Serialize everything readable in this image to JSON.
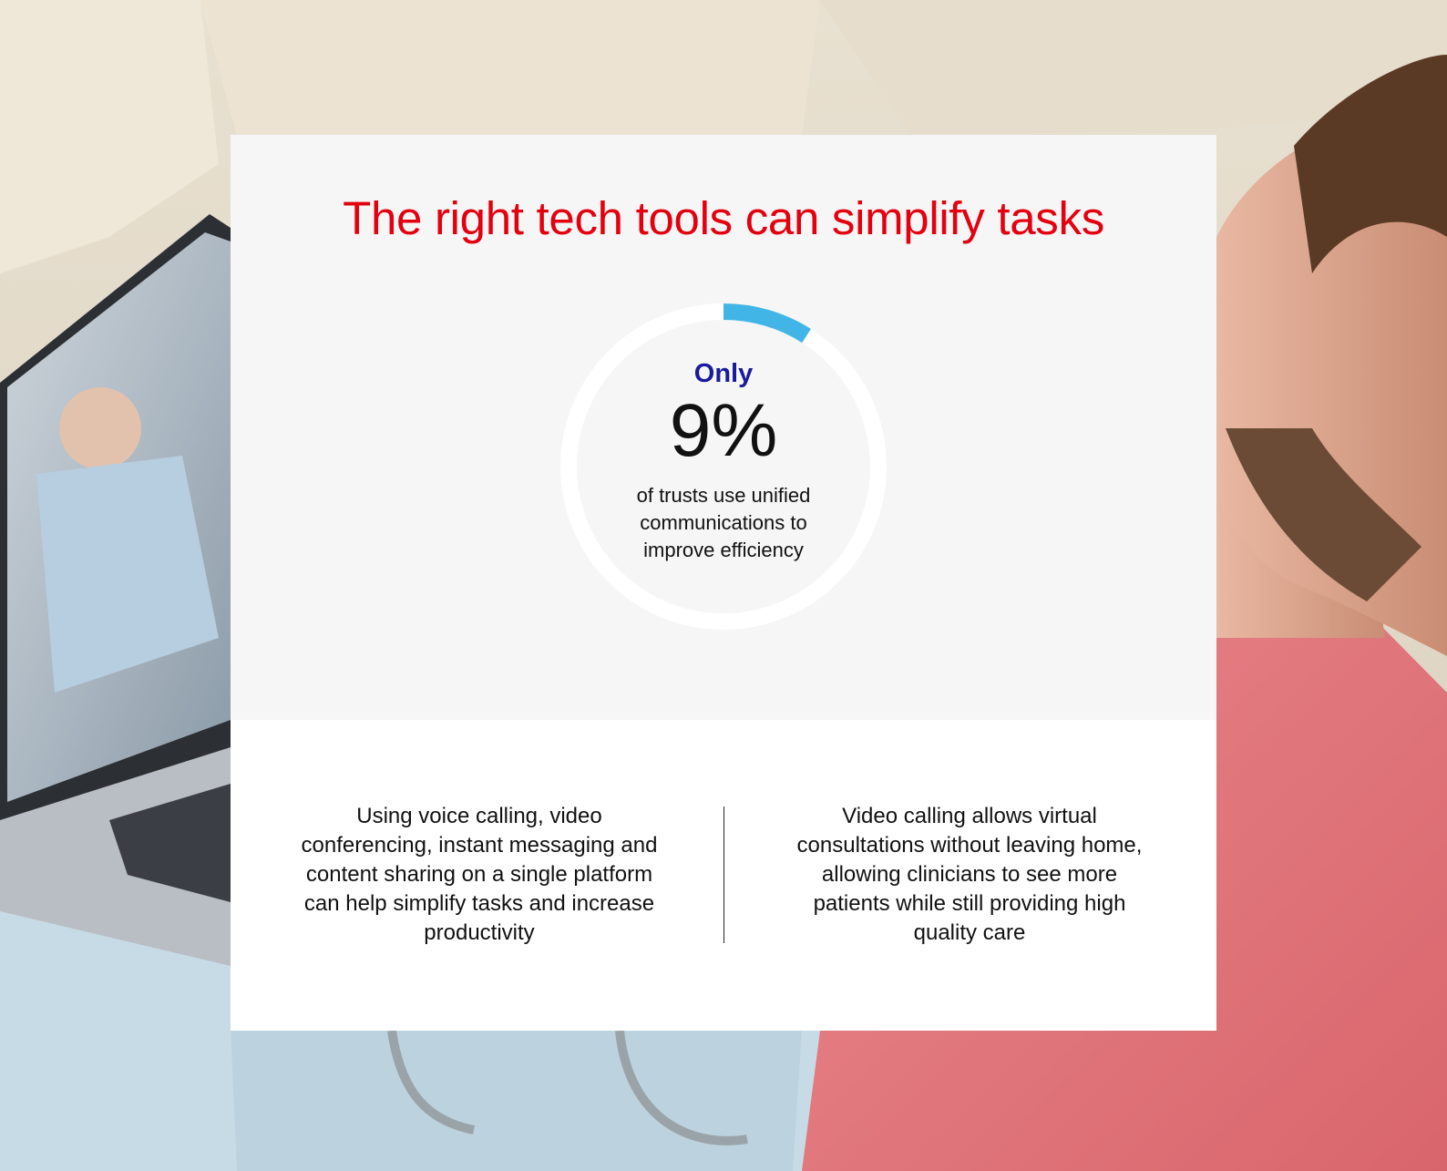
{
  "heading": "The right tech tools can simplify tasks",
  "stat": {
    "prefix": "Only",
    "value_label": "9%",
    "value": 9,
    "caption": "of trusts use unified communications to improve efficiency"
  },
  "columns": [
    "Using voice calling, video conferencing, instant messaging and content sharing on a single platform can help simplify tasks and increase productivity",
    "Video calling allows virtual consultations without leaving home, allowing clinicians to see more patients while still providing high quality care"
  ],
  "colors": {
    "heading": "#e3000f",
    "accent_arc": "#41b6e6",
    "prefix": "#1a1a9c",
    "panel_top": "#f6f6f6",
    "panel_bottom": "#ffffff"
  }
}
